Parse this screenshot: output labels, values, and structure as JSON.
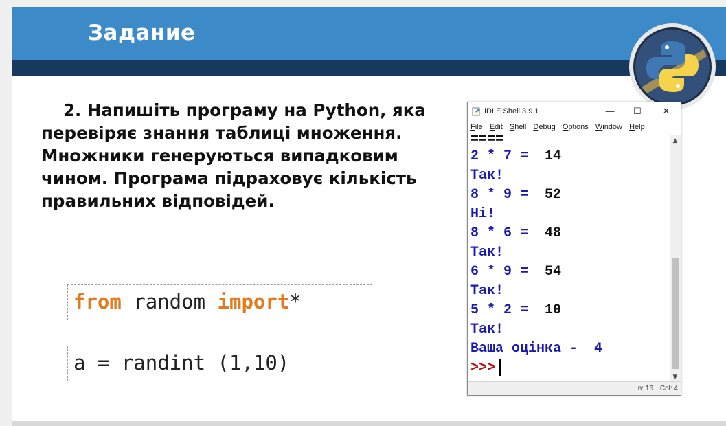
{
  "slide": {
    "title": "Задание",
    "task_text": "2. Напишіть програму на Python, яка перевіряє знання таблиці множення. Множники генеруються випадковим чином. Програма підраховує кількість правильних відповідей."
  },
  "code_snippets": {
    "line1": {
      "kw1": "from",
      "mid": " random ",
      "kw2": "import",
      "tail": "*"
    },
    "line2": "a = randint (1,10)"
  },
  "idle": {
    "title": "IDLE Shell 3.9.1",
    "window_controls": {
      "minimize": "—",
      "maximize": "☐",
      "close": "✕"
    },
    "menu": [
      "File",
      "Edit",
      "Shell",
      "Debug",
      "Options",
      "Window",
      "Help"
    ],
    "lines": [
      {
        "text": "====",
        "color": "black"
      },
      {
        "q": "2 * 7 = ",
        "a": " 14"
      },
      {
        "text": "Так!",
        "color": "blue"
      },
      {
        "q": "8 * 9 = ",
        "a": " 52"
      },
      {
        "text": "Ні!",
        "color": "blue"
      },
      {
        "q": "8 * 6 = ",
        "a": " 48"
      },
      {
        "text": "Так!",
        "color": "blue"
      },
      {
        "q": "6 * 9 = ",
        "a": " 54"
      },
      {
        "text": "Так!",
        "color": "blue"
      },
      {
        "q": "5 * 2 = ",
        "a": " 10"
      },
      {
        "text": "Так!",
        "color": "blue"
      },
      {
        "text": "Ваша оцінка -  4",
        "color": "blue"
      }
    ],
    "prompt": ">>>",
    "status": {
      "ln": "Ln: 16",
      "col": "Col: 4"
    }
  },
  "colors": {
    "header_blue": "#3d8ac8",
    "header_dark": "#17395e",
    "keyword_orange": "#e07b1f",
    "shell_blue": "#1a1ab0",
    "prompt_red": "#b01010"
  },
  "icons": {
    "logo": "python-logo-icon",
    "app": "idle-app-icon"
  }
}
